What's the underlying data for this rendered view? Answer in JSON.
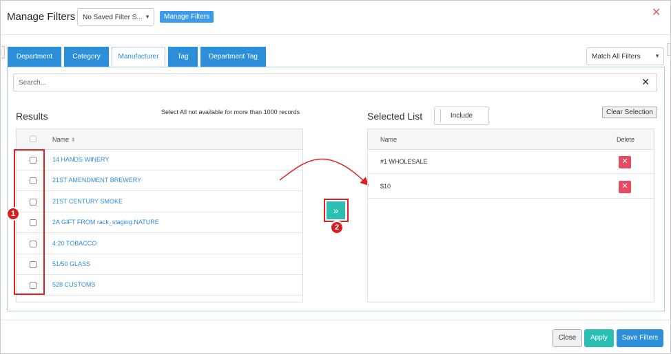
{
  "header": {
    "title": "Manage Filters",
    "saved_filter_value": "No Saved Filter S...",
    "manage_filters_label": "Manage Filters",
    "close_glyph": "✕"
  },
  "tabs": [
    {
      "label": "Department",
      "active": false
    },
    {
      "label": "Category",
      "active": false
    },
    {
      "label": "Manufacturer",
      "active": true
    },
    {
      "label": "Tag",
      "active": false
    },
    {
      "label": "Department Tag",
      "active": false
    }
  ],
  "match_select": {
    "value": "Match All Filters"
  },
  "search": {
    "placeholder": "Search...",
    "clear_glyph": "✕"
  },
  "results": {
    "title": "Results",
    "note": "Select All not available for more than 1000 records",
    "column_name": "Name",
    "rows": [
      "14 HANDS WINERY",
      "21ST AMENDMENT BREWERY",
      "21ST CENTURY SMOKE",
      "2A GIFT FROM rack_staging.NATURE",
      "4:20 TOBACCO",
      "51/50 GLASS",
      "528 CUSTOMS"
    ]
  },
  "annotations": {
    "badge1": "1",
    "badge2": "2"
  },
  "move_button_glyph": "»",
  "selected": {
    "title": "Selected List",
    "include_label": "Include",
    "clear_label": "Clear Selection",
    "column_name": "Name",
    "column_delete": "Delete",
    "rows": [
      "#1 WHOLESALE",
      "$10"
    ],
    "delete_glyph": "✕"
  },
  "footer": {
    "close_label": "Close",
    "apply_label": "Apply",
    "save_label": "Save Filters"
  },
  "colors": {
    "tab_blue": "#2d8fd9",
    "teal": "#2bbfb3",
    "annotation_red": "#e02020",
    "delete_red": "#e84a5f"
  }
}
